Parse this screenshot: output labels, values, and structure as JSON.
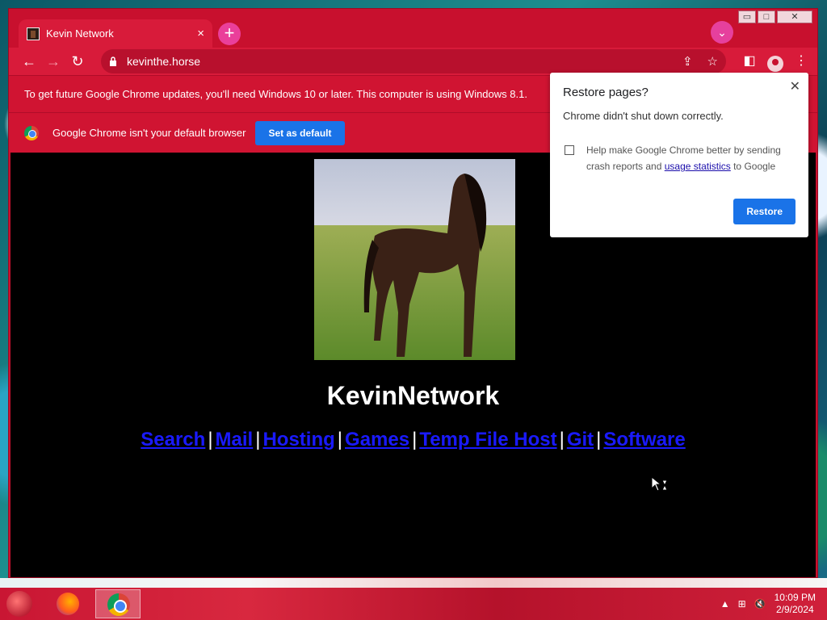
{
  "window": {
    "tab_title": "Kevin Network",
    "tab_close": "×",
    "new_tab": "+",
    "tab_search": "⌄",
    "controls": {
      "minimize": "▭",
      "maximize": "□",
      "close": "✕"
    }
  },
  "toolbar": {
    "back": "←",
    "forward": "→",
    "reload": "↻",
    "url": "kevinthe.horse",
    "share": "⇪",
    "bookmark": "☆",
    "side_panel": "◧",
    "menu": "⋮"
  },
  "infobar_os": {
    "text": "To get future Google Chrome updates, you'll need Windows 10 or later. This computer is using Windows 8.1."
  },
  "infobar_default": {
    "text": "Google Chrome isn't your default browser",
    "button": "Set as default"
  },
  "page": {
    "title": "KevinNetwork",
    "links": [
      "Search",
      "Mail",
      "Hosting",
      "Games",
      "Temp File Host",
      "Git",
      "Software"
    ]
  },
  "restore_popup": {
    "title": "Restore pages?",
    "subtitle": "Chrome didn't shut down correctly.",
    "checkbox_text_before": "Help make Google Chrome better by sending crash reports and ",
    "checkbox_link": "usage statistics",
    "checkbox_text_after": " to Google",
    "close": "✕",
    "button": "Restore",
    "checked": false
  },
  "taskbar": {
    "time": "10:09 PM",
    "date": "2/9/2024",
    "tray_up": "▲",
    "network": "⊞",
    "volume": "🔇"
  },
  "colors": {
    "theme": "#c8102e",
    "accent": "#1a73e8",
    "link": "#1a1aff"
  }
}
